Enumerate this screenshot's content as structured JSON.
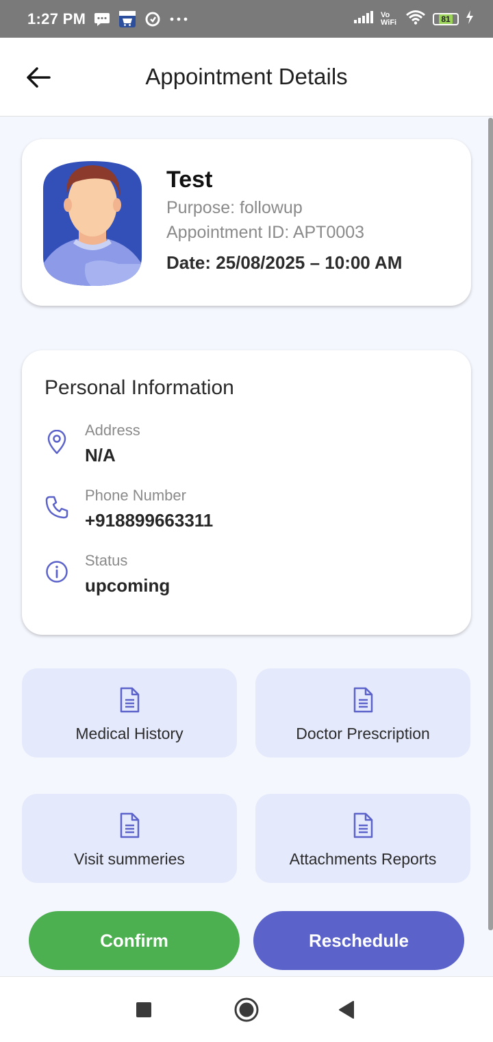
{
  "status_bar": {
    "time": "1:27 PM",
    "notification_icons": [
      "message-icon",
      "amazon-icon",
      "data-saver-icon",
      "more-dots-icon"
    ],
    "network_label": "Vo WiFi",
    "battery_level": "81",
    "icons": [
      "signal-icon",
      "wifi-icon",
      "battery-icon",
      "charging-icon"
    ]
  },
  "header": {
    "back_icon": "arrow-left-icon",
    "title": "Appointment Details"
  },
  "patient": {
    "name": "Test",
    "purpose": "Purpose: followup",
    "appointment_id": "Appointment ID: APT0003",
    "date": "Date: 25/08/2025 – 10:00 AM"
  },
  "personal_info": {
    "title": "Personal Information",
    "items": [
      {
        "icon": "location-pin-icon",
        "label": "Address",
        "value": "N/A"
      },
      {
        "icon": "phone-icon",
        "label": "Phone Number",
        "value": "+918899663311"
      },
      {
        "icon": "info-icon",
        "label": "Status",
        "value": "upcoming"
      }
    ]
  },
  "tiles": [
    {
      "icon": "document-icon",
      "label": "Medical History"
    },
    {
      "icon": "document-icon",
      "label": "Doctor Prescription"
    },
    {
      "icon": "document-icon",
      "label": "Visit summeries"
    },
    {
      "icon": "document-icon",
      "label": "Attachments Reports"
    }
  ],
  "actions": {
    "confirm": "Confirm",
    "reschedule": "Reschedule"
  },
  "colors": {
    "accent": "#5b62c9",
    "confirm": "#4caf50",
    "tile_bg": "#e4e9fc",
    "page_bg": "#f5f7fe"
  },
  "nav_bar": [
    "recents-square-icon",
    "home-circle-icon",
    "back-triangle-icon"
  ]
}
